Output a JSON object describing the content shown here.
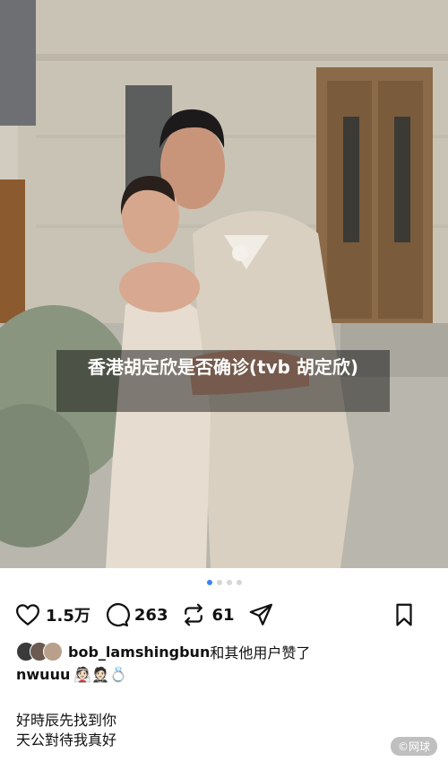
{
  "overlay_title": "香港胡定欣是否确诊(tvb 胡定欣)",
  "carousel": {
    "count": 4,
    "active_index": 0
  },
  "actions": {
    "like_count": "1.5万",
    "comment_count": "263",
    "repost_count": "61"
  },
  "likes_line": {
    "username": "bob_lamshingbun",
    "suffix": "和其他用户赞了"
  },
  "caption": {
    "username": "nwuuu",
    "emoji": "👰🏻🤵🏻💍",
    "lines": [
      "好時辰先找到你",
      "天公對待我真好"
    ]
  },
  "watermark": "©网球",
  "colors": {
    "accent_dot": "#3b82f6"
  }
}
